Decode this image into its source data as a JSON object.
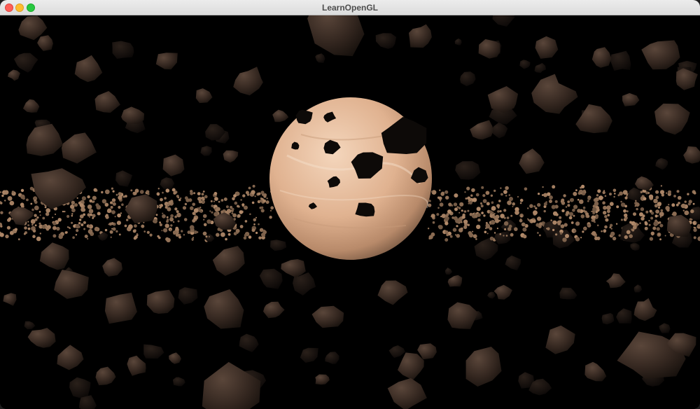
{
  "window": {
    "title": "LearnOpenGL",
    "controls": {
      "close_color": "#ff5f57",
      "minimize_color": "#febc2e",
      "zoom_color": "#28c840"
    }
  },
  "scene": {
    "background_color": "#000000",
    "planet_color": "#e3b896",
    "rock_color": "#3a2c24",
    "ring_color": "#9a7c62"
  }
}
